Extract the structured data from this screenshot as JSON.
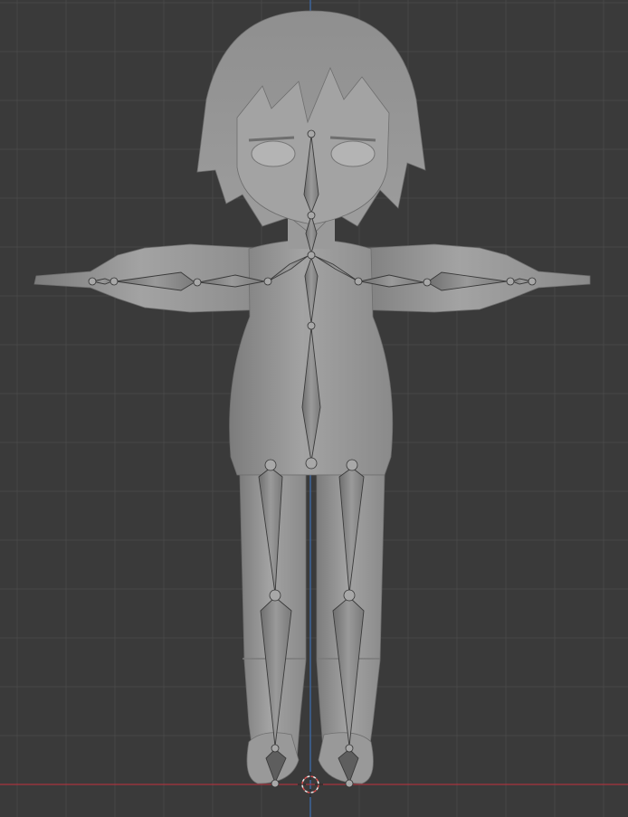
{
  "viewport": {
    "mode": "front-orthographic",
    "background_color": "#3a3a3a",
    "grid_color": "#474747",
    "x_axis_color": "#a8343f",
    "z_axis_color": "#3d6fb4",
    "mesh_color": "#9c9c9c",
    "bone_color": "#8a8a8a"
  },
  "scene": {
    "mesh": "character-mesh",
    "armature": "armature",
    "bones": [
      "head",
      "neck",
      "shoulder-left",
      "shoulder-right",
      "upper-arm-left",
      "forearm-left",
      "hand-left",
      "upper-arm-right",
      "forearm-right",
      "hand-right",
      "spine",
      "spine-lower",
      "thigh-left",
      "shin-left",
      "foot-left",
      "thigh-right",
      "shin-right",
      "foot-right"
    ],
    "cursor": "3d-cursor"
  }
}
